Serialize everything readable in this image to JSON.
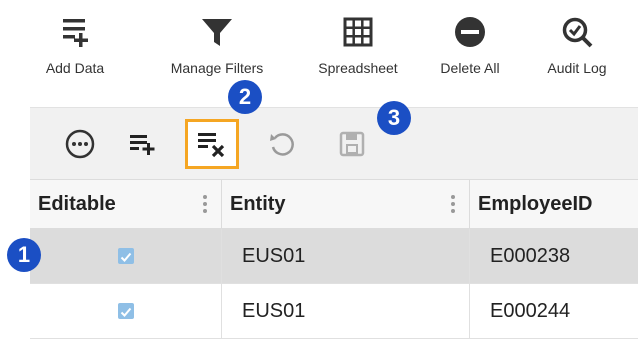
{
  "ribbon": {
    "add_data": "Add Data",
    "manage_filters": "Manage Filters",
    "spreadsheet": "Spreadsheet",
    "delete_all": "Delete All",
    "audit_log": "Audit Log"
  },
  "callouts": {
    "one": "1",
    "two": "2",
    "three": "3"
  },
  "grid": {
    "columns": [
      "Editable",
      "Entity",
      "EmployeeID"
    ],
    "rows": [
      {
        "editable": true,
        "entity": "EUS01",
        "employee_id": "E000238",
        "selected": true
      },
      {
        "editable": true,
        "entity": "EUS01",
        "employee_id": "E000244",
        "selected": false
      }
    ]
  },
  "colors": {
    "highlight": "#f5a623",
    "callout": "#1b4fc4",
    "checkbox": "#8fbfe6"
  }
}
